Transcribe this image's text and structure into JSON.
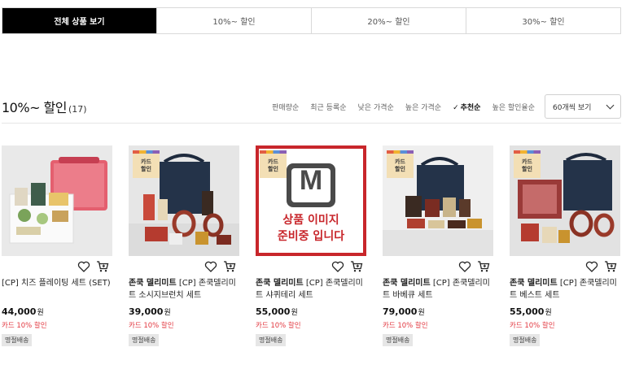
{
  "tabs": [
    {
      "label": "전체 상품 보기",
      "active": true
    },
    {
      "label": "10%~ 할인",
      "active": false
    },
    {
      "label": "20%~ 할인",
      "active": false
    },
    {
      "label": "30%~ 할인",
      "active": false
    }
  ],
  "list": {
    "title": "10%~ 할인",
    "count": "(17)",
    "sort_options": [
      {
        "label": "판매량순",
        "active": false
      },
      {
        "label": "최근 등록순",
        "active": false
      },
      {
        "label": "낮은 가격순",
        "active": false
      },
      {
        "label": "높은 가격순",
        "active": false
      },
      {
        "label": "추천순",
        "active": true
      },
      {
        "label": "높은 할인율순",
        "active": false
      }
    ],
    "page_size": "60개씩 보기"
  },
  "badge": {
    "line1": "카드",
    "line2": "할인"
  },
  "placeholder": {
    "letter": "M",
    "line1": "상품 이미지",
    "line2": "준비중 입니다"
  },
  "products": [
    {
      "brand": "",
      "name": "[CP] 치즈 플레이팅 세트 (SET)",
      "price": "44,000",
      "currency": "원",
      "discount": "카드 10% 할인",
      "tag": "명절배송"
    },
    {
      "brand": "존쿡 델리미트",
      "name": "[CP] 존쿡델리미트 소시지브런치 세트",
      "price": "39,000",
      "currency": "원",
      "discount": "카드 10% 할인",
      "tag": "명절배송"
    },
    {
      "brand": "존쿡 델리미트",
      "name": "[CP] 존쿡델리미트 샤퀴테리 세트",
      "price": "55,000",
      "currency": "원",
      "discount": "카드 10% 할인",
      "tag": "명절배송"
    },
    {
      "brand": "존쿡 델리미트",
      "name": "[CP] 존쿡델리미트 바베큐 세트",
      "price": "79,000",
      "currency": "원",
      "discount": "카드 10% 할인",
      "tag": "명절배송"
    },
    {
      "brand": "존쿡 델리미트",
      "name": "[CP] 존쿡델리미트 베스트 세트",
      "price": "55,000",
      "currency": "원",
      "discount": "카드 10% 할인",
      "tag": "명절배송"
    }
  ],
  "icons": {
    "wish": "heart-icon",
    "cart": "cart-icon"
  },
  "colors": {
    "active_tab": "#000000",
    "discount": "#e2373f",
    "placeholder_red": "#c8262b"
  }
}
